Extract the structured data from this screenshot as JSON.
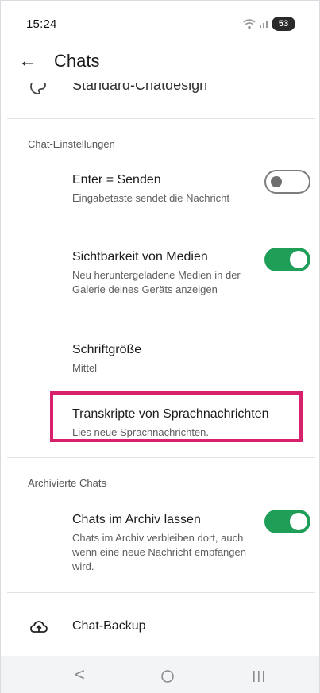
{
  "status": {
    "time": "15:24",
    "battery": "53"
  },
  "appbar": {
    "title": "Chats"
  },
  "clipped_item": {
    "label": "Standard-Chatdesign"
  },
  "sections": {
    "chat_settings": "Chat-Einstellungen",
    "archived": "Archivierte Chats"
  },
  "items": {
    "enter_send": {
      "title": "Enter = Senden",
      "subtitle": "Eingabetaste sendet die Nachricht",
      "toggle": "off"
    },
    "media_visibility": {
      "title": "Sichtbarkeit von Medien",
      "subtitle": "Neu heruntergeladene Medien in der Galerie deines Geräts anzeigen",
      "toggle": "on"
    },
    "font_size": {
      "title": "Schriftgröße",
      "subtitle": "Mittel"
    },
    "transcripts": {
      "title": "Transkripte von Sprachnachrichten",
      "subtitle": "Lies neue Sprachnachrichten."
    },
    "keep_archived": {
      "title": "Chats im Archiv lassen",
      "subtitle": "Chats im Archiv verbleiben dort, auch wenn eine neue Nachricht empfangen wird.",
      "toggle": "on"
    },
    "backup": {
      "label": "Chat-Backup"
    }
  },
  "colors": {
    "accent": "#1f9e58",
    "highlight": "#d8216c"
  },
  "icons": [
    "back-arrow-icon",
    "palette-icon",
    "cloud-upload-icon",
    "wifi-icon",
    "signal-icon"
  ]
}
